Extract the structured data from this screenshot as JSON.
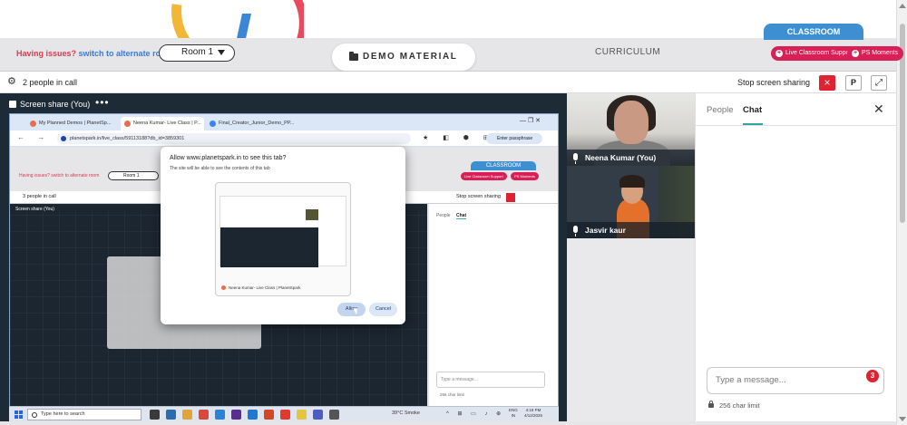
{
  "room_bar": {
    "issues_question": "Having issues?",
    "issues_link": "switch to alternate room",
    "room_selected": "Room 1",
    "demo_tab": "DEMO MATERIAL",
    "curriculum_tab": "CURRICULUM",
    "classroom_tab": "CLASSROOM",
    "live_support": "Live Classroom Support",
    "ps_moments": "PS Moments"
  },
  "call_bar": {
    "people_count": "2 people in call",
    "stop_share": "Stop screen sharing",
    "stop_icon": "×",
    "p_button": "P",
    "expand_icon": "⤢"
  },
  "share": {
    "title": "Screen share (You)",
    "more": "•••"
  },
  "browser": {
    "tabs": [
      "My Planned Demos | PlanetSp...",
      "Neena Kumar- Live Class | P...",
      "Final_Creator_Junior_Demo_PP..."
    ],
    "url": "planetspark.in/live_class/59113188?db_id=3859301",
    "passphrase": "Enter passphrase",
    "nav": "← → ↻",
    "ext_icons": "★ ◧ ⬢ ⊞",
    "win_controls": "— ❐ ✕",
    "inner": {
      "issues": "Having issues? switch to alternate room",
      "room": "Room 1",
      "classroom": "CLASSROOM",
      "support": "Live Classroom Support",
      "moments": "PS Moments",
      "people": "3 people in call",
      "stop": "Stop screen sharing",
      "share_title": "Screen share (You)",
      "people_tab": "People",
      "chat_tab": "Chat",
      "message": "Type a message...",
      "limit": "256 char limit"
    }
  },
  "dialog": {
    "title": "Allow www.planetspark.in to see this tab?",
    "subtitle": "The site will be able to see the contents of this tab",
    "preview_label": "Neena Kumar- Live Class | PlanetSpark",
    "allow": "Allow",
    "cancel": "Cancel"
  },
  "taskbar": {
    "search": "Type here to search",
    "weather": "39°C Smoke",
    "tray": "^ ⊞ ▭ ♪ ⊕",
    "lang_1": "ENG",
    "lang_2": "IN",
    "time": "4:18 PM",
    "date": "4/12/2025",
    "app_colors": [
      "#3a3a3a",
      "#2b6cb0",
      "#e2a33a",
      "#d9483b",
      "#2a83d6",
      "#5c2d91",
      "#1f78d1",
      "#d24726",
      "#e2392f",
      "#e4c441",
      "#4c5cc5",
      "#555555"
    ]
  },
  "videos": [
    {
      "name": "Neena Kumar (You)"
    },
    {
      "name": "Jasvir kaur"
    }
  ],
  "chat": {
    "people_tab": "People",
    "chat_tab": "Chat",
    "close": "✕",
    "placeholder": "Type a message...",
    "unread": "3",
    "char_limit": "256 char limit"
  },
  "colors": {
    "accent_red": "#d81f57",
    "stop_red": "#e02131",
    "classroom_blue": "#3d8fd1",
    "chat_underline": "#2ea6a0"
  }
}
